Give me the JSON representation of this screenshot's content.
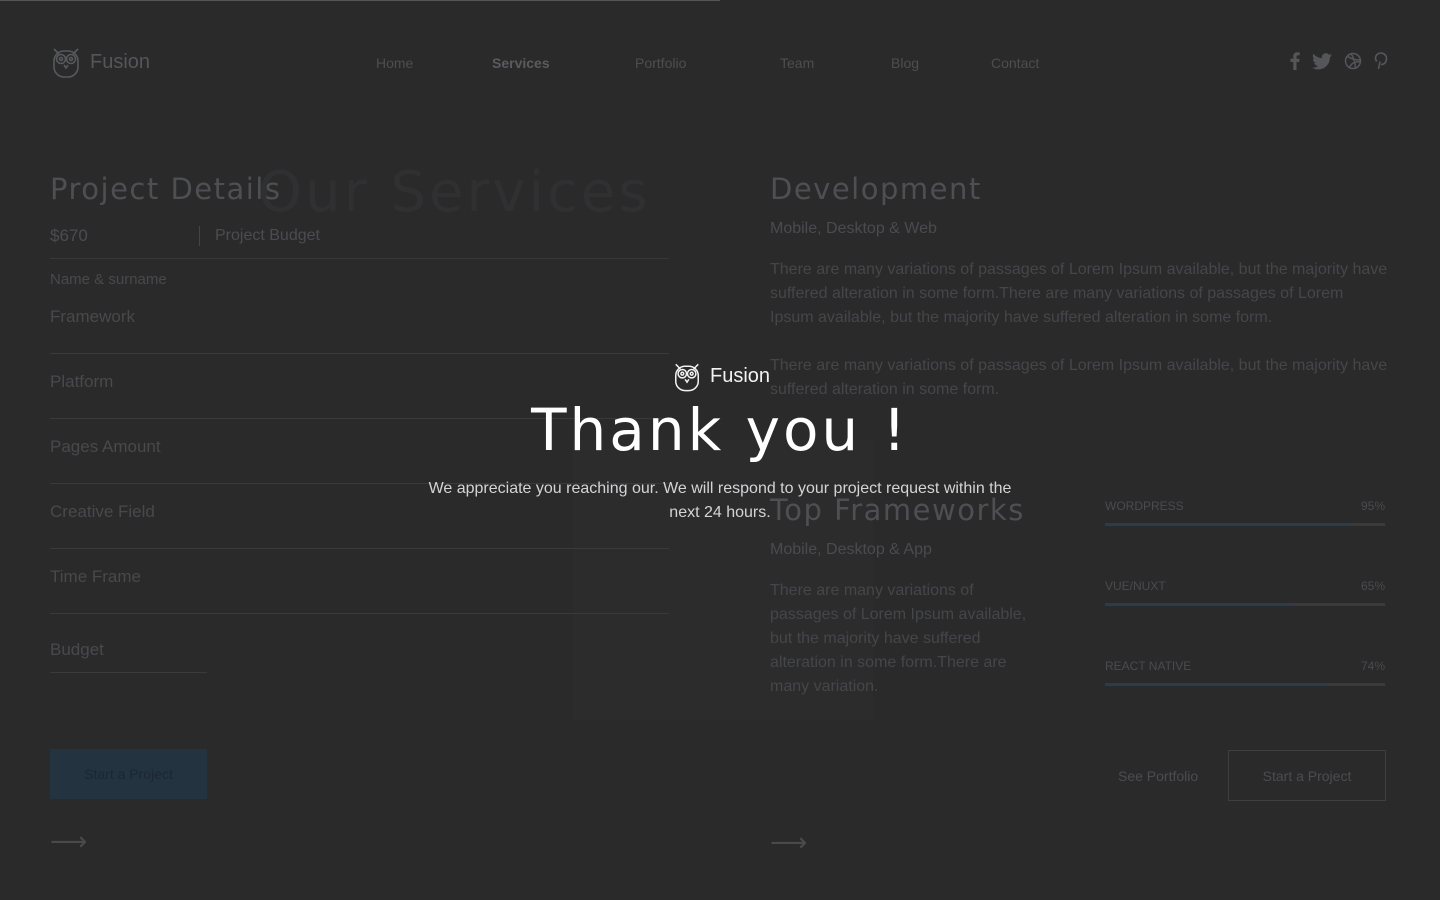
{
  "brand": {
    "name": "Fusion"
  },
  "nav": [
    "Home",
    "Services",
    "Portfolio",
    "Team",
    "Blog",
    "Contact"
  ],
  "social": [
    "facebook-icon",
    "twitter-icon",
    "dribbble-icon",
    "pinterest-icon"
  ],
  "background_heading": "Our Services",
  "project_details": {
    "title": "Project Details",
    "budget_value": "$670",
    "budget_label": "Project Budget",
    "name_label": "Name & surname",
    "fields": [
      "Framework",
      "Platform",
      "Pages Amount",
      "Creative Field",
      "Time Frame"
    ],
    "budget_field": "Budget",
    "start_button": "Start a Project"
  },
  "development": {
    "title": "Development",
    "subtitle": "Mobile, Desktop & Web",
    "para1": "There are many variations of passages of Lorem Ipsum available, but the majority have suffered alteration in some form.There are many variations of passages of Lorem Ipsum available, but the majority have suffered alteration in some form.",
    "para2": "There are many variations of passages of Lorem Ipsum available, but the majority have suffered alteration in some form."
  },
  "top_frameworks": {
    "title": "Top Frameworks",
    "subtitle": "Mobile, Desktop & App",
    "para": "There are many variations of passages of Lorem Ipsum available, but the majority have suffered alteration in some form.There are many variation."
  },
  "skills": [
    {
      "name": "WORDPRESS",
      "percent_label": "95%",
      "value": 0.89
    },
    {
      "name": "VUE/NUXT",
      "percent_label": "65%",
      "value": 0.665
    },
    {
      "name": "REACT NATIVE",
      "percent_label": "74%",
      "value": 0.8
    }
  ],
  "actions": {
    "see_portfolio": "See Portfolio",
    "start_project": "Start a Project"
  },
  "modal": {
    "logo_text": "Fusion",
    "title": "Thank you !",
    "message": "We appreciate you reaching our. We will respond to your project request within the next 24 hours."
  },
  "colors": {
    "accent": "#2b3c4b",
    "background": "#2a2a2b",
    "overlay_text": "#ffffff"
  }
}
